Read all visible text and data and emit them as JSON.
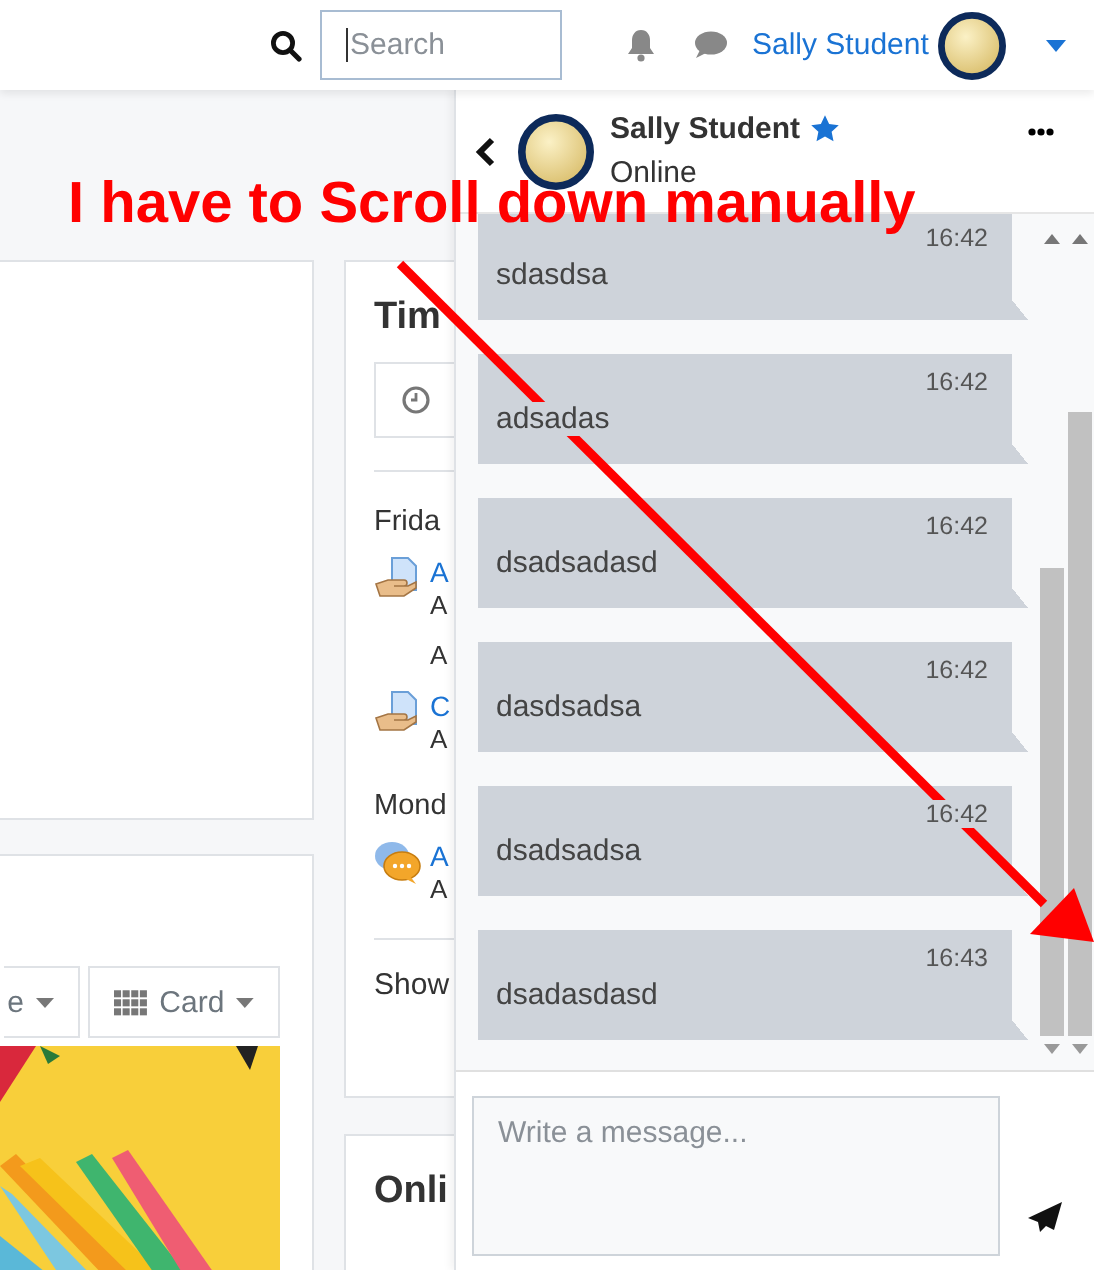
{
  "navbar": {
    "search": {
      "placeholder": "Search"
    },
    "user_name": "Sally Student"
  },
  "courses_card": {
    "view_controls": [
      {
        "label": "e"
      },
      {
        "label": "Card"
      }
    ]
  },
  "timeline": {
    "title": "Tim",
    "groups": [
      {
        "day": "Frida",
        "items": [
          {
            "kind": "assignment",
            "title": "A",
            "lines": [
              "A",
              "A"
            ]
          },
          {
            "kind": "assignment",
            "title": "C",
            "lines": [
              "A"
            ]
          }
        ]
      },
      {
        "day": "Mond",
        "items": [
          {
            "kind": "forum",
            "title": "A",
            "lines": [
              "A"
            ]
          }
        ]
      }
    ],
    "show_more": "Show"
  },
  "online_card": {
    "title": "Onli"
  },
  "chat": {
    "contact": {
      "name": "Sally Student",
      "starred": true,
      "status": "Online"
    },
    "messages": [
      {
        "time": "16:42",
        "text": "sdasdsa"
      },
      {
        "time": "16:42",
        "text": "adsadas"
      },
      {
        "time": "16:42",
        "text": "dsadsadasd"
      },
      {
        "time": "16:42",
        "text": "dasdsadsa"
      },
      {
        "time": "16:42",
        "text": "dsadsadsa"
      },
      {
        "time": "16:43",
        "text": "dsadasdasd"
      }
    ],
    "composer": {
      "placeholder": "Write a message..."
    }
  },
  "annotation": {
    "text": "I have to Scroll down manually"
  }
}
